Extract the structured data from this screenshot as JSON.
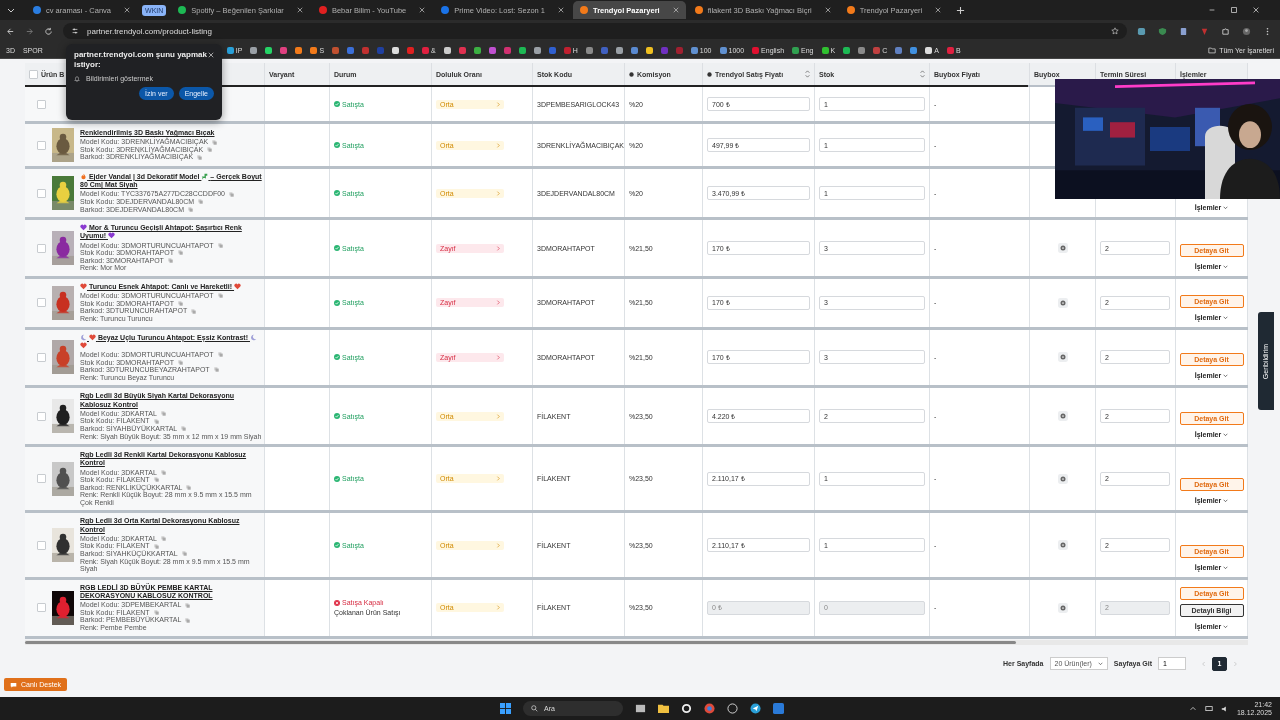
{
  "browser": {
    "tabs": [
      {
        "kind": "tab",
        "title": "cv araması - Canva",
        "color": "#2a7de1",
        "selected": false
      },
      {
        "kind": "group",
        "title": "WKIN"
      },
      {
        "kind": "tab",
        "title": "Spotify – Beğenilen Şarkılar",
        "color": "#1db954",
        "selected": false
      },
      {
        "kind": "tab",
        "title": "Bebar Bilim - YouTube",
        "color": "#e02020",
        "selected": false
      },
      {
        "kind": "tab",
        "title": "Prime Video: Lost: Sezon 1",
        "color": "#1a73e8",
        "selected": false
      },
      {
        "kind": "tab",
        "title": "Trendyol Pazaryeri",
        "color": "#f27a1a",
        "selected": true
      },
      {
        "kind": "tab",
        "title": "filakent 3D Baskı Yağmacı Biçri",
        "color": "#f27a1a",
        "selected": false
      },
      {
        "kind": "tab",
        "title": "Trendyol Pazaryeri",
        "color": "#f27a1a",
        "selected": false
      }
    ],
    "address": "partner.trendyol.com/product-listing",
    "bookmarks": [
      {
        "label": "3D"
      },
      {
        "label": "SPOR"
      }
    ],
    "bookmarks_more": [
      {
        "label": "IP",
        "color": "#29a0d8"
      },
      {
        "color": "#9aa0a6"
      },
      {
        "color": "#25d366"
      },
      {
        "color": "#e04080"
      },
      {
        "color": "#f27a1a"
      },
      {
        "label": "S",
        "color": "#f27a1a"
      },
      {
        "color": "#c05030"
      },
      {
        "color": "#3b6fd8"
      },
      {
        "color": "#c03030"
      },
      {
        "color": "#2040a0"
      },
      {
        "color": "#dddddd"
      },
      {
        "color": "#e02020"
      },
      {
        "label": "&",
        "color": "#e02040"
      },
      {
        "color": "#cccccc"
      },
      {
        "color": "#e03050"
      },
      {
        "color": "#3cb043"
      },
      {
        "color": "#c050d0"
      },
      {
        "color": "#d03070"
      },
      {
        "color": "#1db954"
      },
      {
        "color": "#9aa0a6"
      },
      {
        "color": "#3060d0"
      },
      {
        "label": "H",
        "color": "#c02030"
      },
      {
        "color": "#8a8a8a"
      },
      {
        "color": "#4060c0"
      },
      {
        "color": "#9aa0a6"
      },
      {
        "color": "#5a8ad0"
      },
      {
        "color": "#f0c020"
      },
      {
        "color": "#7030c0"
      },
      {
        "color": "#a02030"
      },
      {
        "label": "100",
        "color": "#6090d0"
      },
      {
        "label": "1000",
        "color": "#6090d0"
      },
      {
        "label": "English",
        "color": "#e01030"
      },
      {
        "label": "Eng",
        "color": "#30a050"
      },
      {
        "label": "K",
        "color": "#30c030"
      },
      {
        "color": "#1db954"
      },
      {
        "color": "#8a8a8a"
      },
      {
        "label": "C",
        "color": "#c04040"
      },
      {
        "color": "#6080c0"
      },
      {
        "color": "#4090e0"
      },
      {
        "label": "A",
        "color": "#dddddd"
      },
      {
        "label": "B",
        "color": "#e02040"
      }
    ],
    "all_bookmarks": "Tüm Yer İşaretleri"
  },
  "permission_popup": {
    "title": "partner.trendyol.com şunu yapmak istiyor:",
    "permission": "Bildirimleri göstermek",
    "buttons": [
      "İzin ver",
      "Engelle"
    ]
  },
  "table": {
    "select_all": {
      "checked": false
    },
    "columns": [
      {
        "label": "Ürün B",
        "info": false,
        "sortable": false
      },
      {
        "label": "Varyant",
        "info": false,
        "sortable": false
      },
      {
        "label": "Durum",
        "info": false,
        "sortable": false
      },
      {
        "label": "Doluluk Oranı",
        "info": false,
        "sortable": false
      },
      {
        "label": "Stok Kodu",
        "info": false,
        "sortable": false
      },
      {
        "label": "Komisyon",
        "info": true,
        "sortable": false
      },
      {
        "label": "Trendyol Satış Fiyatı",
        "info": true,
        "sortable": true
      },
      {
        "label": "Stok",
        "info": false,
        "sortable": true
      },
      {
        "label": "Buybox Fiyatı",
        "info": false,
        "sortable": false
      },
      {
        "label": "Buybox",
        "info": false,
        "sortable": false
      },
      {
        "label": "Termin Süresi",
        "info": false,
        "sortable": false
      },
      {
        "label": "İşlemler",
        "info": false,
        "sortable": false
      }
    ],
    "rows": [
      {
        "checked": false,
        "status": {
          "kind": "on",
          "label": "Satışta"
        },
        "fill": {
          "kind": "medium",
          "label": "Orta"
        },
        "stock_code": "3DPEMBESARIGLOCK43",
        "commission": "%20",
        "price": {
          "value": "700 ₺",
          "disabled": false
        },
        "stock": {
          "value": "1",
          "disabled": false
        },
        "buybox_price": "-",
        "actions": []
      },
      {
        "checked": false,
        "product": {
          "title": [
            {
              "kind": "text",
              "text": "Renklendirilmiş 3D Baskı Yağmacı Bıçak"
            }
          ],
          "lines": [
            "Model Kodu: 3DRENKLİYAĞMACIBIÇAK",
            "Stok Kodu: 3DRENKLİYAĞMACIBIÇAK",
            "Barkod: 3DRENKLİYAĞMACIBIÇAK"
          ]
        },
        "status": {
          "kind": "on",
          "label": "Satışta"
        },
        "fill": {
          "kind": "medium",
          "label": "Orta"
        },
        "stock_code": "3DRENKLİYAĞMACIBIÇAK",
        "commission": "%20",
        "price": {
          "value": "497,99 ₺",
          "disabled": false
        },
        "stock": {
          "value": "1",
          "disabled": false
        },
        "buybox_price": "-",
        "actions": []
      },
      {
        "checked": false,
        "product": {
          "title": [
            {
              "kind": "flame"
            },
            {
              "kind": "text",
              "text": "Ejder Vandal | 3d Dekoratif Model"
            },
            {
              "kind": "dino"
            },
            {
              "kind": "text",
              "text": "– Gerçek Boyut 80 Cm| Mat Siyah"
            }
          ],
          "lines": [
            "Model Kodu: TYC337675A277DC28CCDDF00",
            "Stok Kodu: 3DEJDERVANDAL80CM",
            "Barkod: 3DEJDERVANDAL80CM"
          ]
        },
        "status": {
          "kind": "on",
          "label": "Satışta"
        },
        "fill": {
          "kind": "medium",
          "label": "Orta"
        },
        "stock_code": "3DEJDERVANDAL80CM",
        "commission": "%20",
        "price": {
          "value": "3.470,99 ₺",
          "disabled": false
        },
        "stock": {
          "value": "1",
          "disabled": false
        },
        "buybox_price": "-",
        "actions": [
          {
            "kind": "menu",
            "label": "İşlemler"
          }
        ]
      },
      {
        "checked": false,
        "product": {
          "title": [
            {
              "kind": "purple-heart"
            },
            {
              "kind": "text",
              "text": "Mor & Turuncu Geçişli Ahtapot: Şaşırtıcı Renk Uyumu!"
            },
            {
              "kind": "purple-heart"
            }
          ],
          "lines": [
            "Model Kodu: 3DMORTURUNCUAHTAPOT",
            "Stok Kodu: 3DMORAHTAPOT",
            "Barkod: 3DMORAHTAPOT",
            "Renk: Mor Mor"
          ]
        },
        "status": {
          "kind": "on",
          "label": "Satışta"
        },
        "fill": {
          "kind": "weak",
          "label": "Zayıf"
        },
        "stock_code": "3DMORAHTAPOT",
        "commission": "%21,50",
        "price": {
          "value": "170 ₺",
          "disabled": false
        },
        "stock": {
          "value": "3",
          "disabled": false
        },
        "buybox_price": "-",
        "buybox_icon": true,
        "lead_time": {
          "value": "2",
          "disabled": false
        },
        "actions": [
          {
            "kind": "detail",
            "label": "Detaya Git"
          },
          {
            "kind": "menu",
            "label": "İşlemler"
          }
        ]
      },
      {
        "checked": false,
        "product": {
          "title": [
            {
              "kind": "heart"
            },
            {
              "kind": "text",
              "text": "Turuncu Esnek Ahtapot: Canlı ve Hareketli!"
            },
            {
              "kind": "heart"
            }
          ],
          "lines": [
            "Model Kodu: 3DMORTURUNCUAHTAPOT",
            "Stok Kodu: 3DMORAHTAPOT",
            "Barkod: 3DTURUNCURAHTAPOT",
            "Renk: Turuncu Turuncu"
          ]
        },
        "status": {
          "kind": "on",
          "label": "Satışta"
        },
        "fill": {
          "kind": "weak",
          "label": "Zayıf"
        },
        "stock_code": "3DMORAHTAPOT",
        "commission": "%21,50",
        "price": {
          "value": "170 ₺",
          "disabled": false
        },
        "stock": {
          "value": "3",
          "disabled": false
        },
        "buybox_price": "-",
        "buybox_icon": true,
        "lead_time": {
          "value": "2",
          "disabled": false
        },
        "actions": [
          {
            "kind": "detail",
            "label": "Detaya Git"
          },
          {
            "kind": "menu",
            "label": "İşlemler"
          }
        ]
      },
      {
        "checked": false,
        "product": {
          "title": [
            {
              "kind": "moon"
            },
            {
              "kind": "heart"
            },
            {
              "kind": "text",
              "text": "Beyaz Uçlu Turuncu Ahtapot: Eşsiz Kontrast!"
            },
            {
              "kind": "moon"
            },
            {
              "kind": "heart"
            }
          ],
          "lines": [
            "Model Kodu: 3DMORTURUNCUAHTAPOT",
            "Stok Kodu: 3DMORAHTAPOT",
            "Barkod: 3DTURUNCUBEYAZRAHTAPOT",
            "Renk: Turuncu Beyaz Turuncu"
          ]
        },
        "status": {
          "kind": "on",
          "label": "Satışta"
        },
        "fill": {
          "kind": "weak",
          "label": "Zayıf"
        },
        "stock_code": "3DMORAHTAPOT",
        "commission": "%21,50",
        "price": {
          "value": "170 ₺",
          "disabled": false
        },
        "stock": {
          "value": "3",
          "disabled": false
        },
        "buybox_price": "-",
        "buybox_icon": true,
        "lead_time": {
          "value": "2",
          "disabled": false
        },
        "actions": [
          {
            "kind": "detail",
            "label": "Detaya Git"
          },
          {
            "kind": "menu",
            "label": "İşlemler"
          }
        ]
      },
      {
        "checked": false,
        "product": {
          "title": [
            {
              "kind": "text",
              "text": "Rgb Ledli 3d Büyük Siyah Kartal Dekorasyonu Kablosuz Kontrol"
            }
          ],
          "lines": [
            "Model Kodu: 3DKARTAL",
            "Stok Kodu: FİLAKENT",
            "Barkod: SİYAHBÜYÜKKARTAL",
            "Renk: Siyah Büyük Boyut: 35 mm x 12 mm x 19 mm Siyah"
          ]
        },
        "status": {
          "kind": "on",
          "label": "Satışta"
        },
        "fill": {
          "kind": "medium",
          "label": "Orta"
        },
        "stock_code": "FİLAKENT",
        "commission": "%23,50",
        "price": {
          "value": "4.220 ₺",
          "disabled": false
        },
        "stock": {
          "value": "2",
          "disabled": false
        },
        "buybox_price": "-",
        "buybox_icon": true,
        "lead_time": {
          "value": "2",
          "disabled": false
        },
        "actions": [
          {
            "kind": "detail",
            "label": "Detaya Git"
          },
          {
            "kind": "menu",
            "label": "İşlemler"
          }
        ]
      },
      {
        "checked": false,
        "product": {
          "title": [
            {
              "kind": "text",
              "text": "Rgb Ledli 3d Renkli Kartal Dekorasyonu Kablosuz Kontrol"
            }
          ],
          "lines": [
            "Model Kodu: 3DKARTAL",
            "Stok Kodu: FİLAKENT",
            "Barkod: RENKLİKÜÇÜKKARTAL",
            "Renk: Renkli Küçük Boyut: 28 mm x 9.5 mm x 15.5 mm Çok Renkli"
          ]
        },
        "status": {
          "kind": "on",
          "label": "Satışta"
        },
        "fill": {
          "kind": "medium",
          "label": "Orta"
        },
        "stock_code": "FİLAKENT",
        "commission": "%23,50",
        "price": {
          "value": "2.110,17 ₺",
          "disabled": false
        },
        "stock": {
          "value": "1",
          "disabled": false
        },
        "buybox_price": "-",
        "buybox_icon": true,
        "lead_time": {
          "value": "2",
          "disabled": false
        },
        "actions": [
          {
            "kind": "detail",
            "label": "Detaya Git"
          },
          {
            "kind": "menu",
            "label": "İşlemler"
          }
        ]
      },
      {
        "checked": false,
        "product": {
          "title": [
            {
              "kind": "text",
              "text": "Rgb Ledli 3d Orta Kartal Dekorasyonu Kablosuz Kontrol"
            }
          ],
          "lines": [
            "Model Kodu: 3DKARTAL",
            "Stok Kodu: FİLAKENT",
            "Barkod: SİYAHKÜÇÜKKARTAL",
            "Renk: Siyah Küçük Boyut: 28 mm x 9.5 mm x 15.5 mm Siyah"
          ]
        },
        "status": {
          "kind": "on",
          "label": "Satışta"
        },
        "fill": {
          "kind": "medium",
          "label": "Orta"
        },
        "stock_code": "FİLAKENT",
        "commission": "%23,50",
        "price": {
          "value": "2.110,17 ₺",
          "disabled": false
        },
        "stock": {
          "value": "1",
          "disabled": false
        },
        "buybox_price": "-",
        "buybox_icon": true,
        "lead_time": {
          "value": "2",
          "disabled": false
        },
        "actions": [
          {
            "kind": "detail",
            "label": "Detaya Git"
          },
          {
            "kind": "menu",
            "label": "İşlemler"
          }
        ]
      },
      {
        "checked": false,
        "product": {
          "title": [
            {
              "kind": "text",
              "text": "RGB LEDLİ 3D BÜYÜK PEMBE KARTAL DEKORASYONU KABLOSUZ KONTROL"
            }
          ],
          "lines": [
            "Model Kodu: 3DPEMBEKARTAL",
            "Stok Kodu: FİLAKENT",
            "Barkod: PEMBEBÜYÜKKARTAL",
            "Renk: Pembe Pembe"
          ]
        },
        "status": {
          "kind": "off",
          "label": "Satışa Kapalı",
          "note": "Çoklanan Ürün Satışı"
        },
        "fill": {
          "kind": "medium",
          "label": "Orta"
        },
        "stock_code": "FİLAKENT",
        "commission": "%23,50",
        "price": {
          "value": "0 ₺",
          "disabled": true
        },
        "stock": {
          "value": "0",
          "disabled": true
        },
        "buybox_price": "-",
        "buybox_icon": true,
        "lead_time": {
          "value": "2",
          "disabled": true
        },
        "actions": [
          {
            "kind": "detail",
            "label": "Detaya Git"
          },
          {
            "kind": "info",
            "label": "Detaylı Bilgi"
          },
          {
            "kind": "menu",
            "label": "İşlemler"
          }
        ]
      }
    ]
  },
  "pagination": {
    "per_page_label": "Her Sayfada",
    "per_page": "20 Ürün(ler)",
    "goto_label": "Sayfaya Git",
    "goto_value": "1",
    "pages": [
      {
        "label": "1",
        "selected": true
      }
    ]
  },
  "live_support": "Canlı Destek",
  "feedback_tab": "Geribildirim",
  "taskbar": {
    "search": "Ara",
    "time": "21:42",
    "date": "18.12.2025"
  }
}
